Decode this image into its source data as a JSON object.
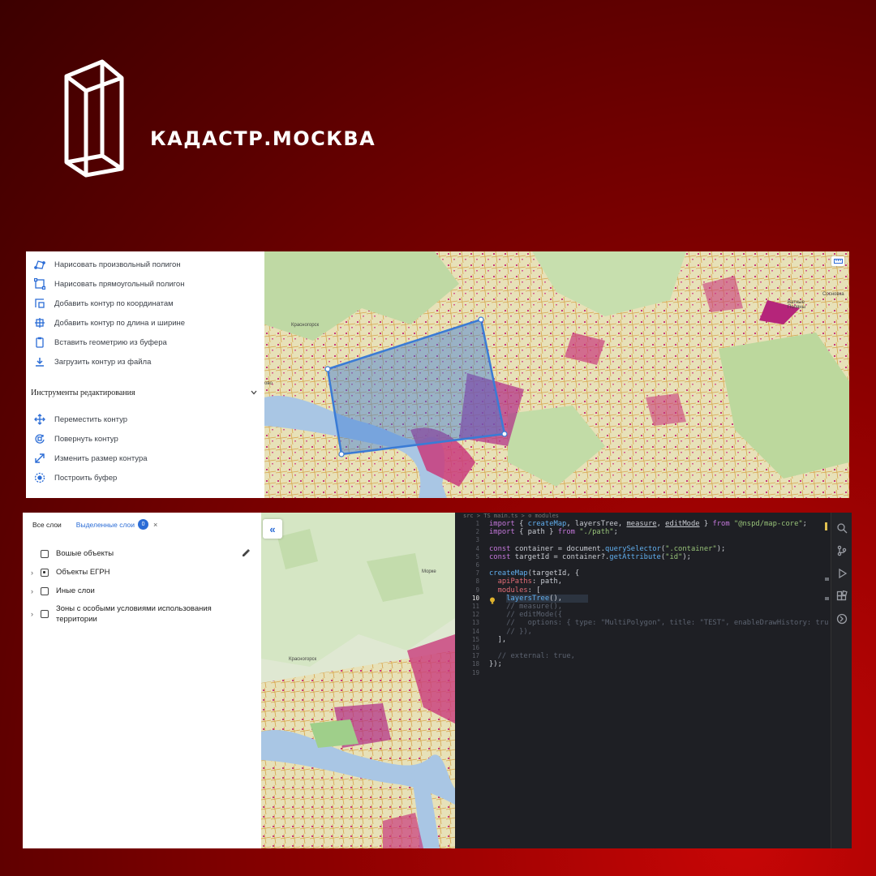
{
  "brand": {
    "name": "КАДАСТР.МОСКВА"
  },
  "drawing_tools": {
    "items": [
      {
        "label": "Нарисовать произвольный полигон",
        "icon": "polygon-draw-icon"
      },
      {
        "label": "Нарисовать прямоугольный полигон",
        "icon": "rectangle-draw-icon"
      },
      {
        "label": "Добавить контур по координатам",
        "icon": "coordinates-icon"
      },
      {
        "label": "Добавить контур по длина и ширине",
        "icon": "dimensions-icon"
      },
      {
        "label": "Вставить геометрию из буфера",
        "icon": "clipboard-icon"
      },
      {
        "label": "Загрузить контур из файла",
        "icon": "upload-icon"
      }
    ]
  },
  "edit_tools": {
    "section_title": "Инструменты редактирования",
    "items": [
      {
        "label": "Переместить контур",
        "icon": "move-icon"
      },
      {
        "label": "Повернуть контур",
        "icon": "rotate-icon"
      },
      {
        "label": "Изменить размер контура",
        "icon": "resize-icon"
      },
      {
        "label": "Построить буфер",
        "icon": "buffer-icon"
      }
    ]
  },
  "map_top": {
    "labels": [
      "Красногорск",
      "Ватные Поляны",
      "Сосновка",
      "ово"
    ],
    "polygon_color": "#3a7bd5"
  },
  "layers_panel": {
    "tabs": {
      "all": "Все слои",
      "selected": "Выделенные слои",
      "selected_count": "0",
      "close": "×"
    },
    "layers": [
      {
        "label": "Вошые объекты",
        "expandable": false,
        "checked": false
      },
      {
        "label": "Объекты ЕГРН",
        "expandable": true,
        "checked": true
      },
      {
        "label": "Иные слои",
        "expandable": true,
        "checked": false
      },
      {
        "label": "Зоны с особыми условиями использования территории",
        "expandable": true,
        "checked": false
      }
    ],
    "collapse_symbol": "«"
  },
  "map_bottom": {
    "labels": [
      "Красногорск",
      "Морке"
    ]
  },
  "editor": {
    "breadcrumb": "src > TS main.ts > ⊙ modules",
    "current_line": 10,
    "line_numbers": [
      "1",
      "2",
      "3",
      "4",
      "5",
      "6",
      "7",
      "8",
      "9",
      "10",
      "11",
      "12",
      "13",
      "14",
      "15",
      "16",
      "17",
      "18",
      "19"
    ]
  },
  "colors": {
    "accent": "#2b6cd6",
    "background_red": "#8c0000",
    "editor_bg": "#1e1f24"
  }
}
